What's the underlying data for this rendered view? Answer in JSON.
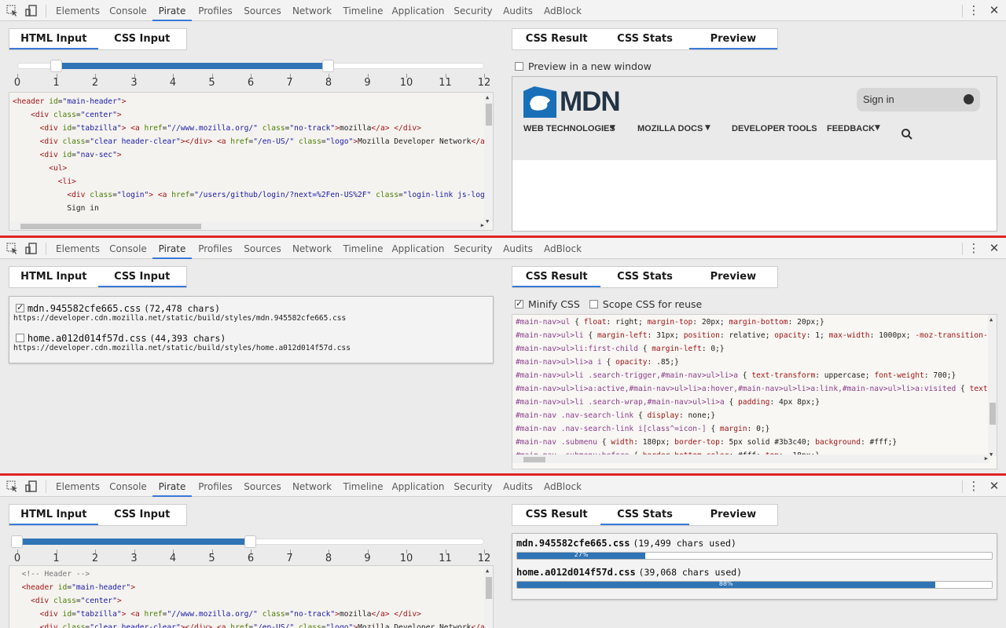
{
  "devtools_tabs": [
    "Elements",
    "Console",
    "Pirate",
    "Profiles",
    "Sources",
    "Network",
    "Timeline",
    "Application",
    "Security",
    "Audits",
    "AdBlock"
  ],
  "input_tabs": [
    "HTML Input",
    "CSS Input"
  ],
  "result_tabs": [
    "CSS Result",
    "CSS Stats",
    "Preview"
  ],
  "icons": {
    "inspect": "inspect-element-icon",
    "device": "device-mode-icon",
    "menu": "more-options-icon",
    "close": "close-icon"
  },
  "colors": {
    "accent": "#3879d9",
    "slider_fill": "#2f74b5",
    "divider": "#e02424"
  },
  "panel1": {
    "slider": {
      "ticks": [
        "0",
        "1",
        "2",
        "3",
        "4",
        "5",
        "6",
        "7",
        "8",
        "9",
        "10",
        "11",
        "12"
      ],
      "range_low": 1,
      "range_high": 8
    },
    "html_lines": [
      "<header id=\"main-header\">",
      "    <div class=\"center\">",
      "      <div id=\"tabzilla\"> <a href=\"//www.mozilla.org/\" class=\"no-track\">mozilla</a> </div>",
      "      <div class=\"clear header-clear\"></div> <a href=\"/en-US/\" class=\"logo\">Mozilla Developer Network</a>",
      "      <div id=\"nav-sec\">",
      "        <ul>",
      "          <li>",
      "            <div class=\"login\"> <a href=\"/users/github/login/?next=%2Fen-US%2F\" class=\"login-link js-login",
      "            Sign in"
    ],
    "preview_checkbox": "Preview in a new window",
    "mdn": {
      "logo_text": "MDN",
      "signin": "Sign in",
      "nav": [
        "WEB TECHNOLOGIES",
        "MOZILLA DOCS",
        "DEVELOPER TOOLS",
        "FEEDBACK"
      ]
    }
  },
  "panel2": {
    "files": [
      {
        "name": "mdn.945582cfe665.css",
        "chars": "(72,478 chars)",
        "url": "https://developer.cdn.mozilla.net/static/build/styles/mdn.945582cfe665.css",
        "checked": true
      },
      {
        "name": "home.a012d014f57d.css",
        "chars": "(44,393 chars)",
        "url": "https://developer.cdn.mozilla.net/static/build/styles/home.a012d014f57d.css",
        "checked": false
      }
    ],
    "minify_label": "Minify CSS",
    "scope_label": "Scope CSS for reuse",
    "css_lines": [
      [
        [
          "sel",
          "#main-nav>ul"
        ],
        [
          "pv",
          " { "
        ],
        [
          "prop",
          "float"
        ],
        [
          "pv",
          ": right; "
        ],
        [
          "prop",
          "margin-top"
        ],
        [
          "pv",
          ": 20px; "
        ],
        [
          "prop",
          "margin-bottom"
        ],
        [
          "pv",
          ": 20px;}"
        ]
      ],
      [
        [
          "sel",
          "#main-nav>ul>li"
        ],
        [
          "pv",
          " { "
        ],
        [
          "prop",
          "margin-left"
        ],
        [
          "pv",
          ": 31px; "
        ],
        [
          "prop",
          "position"
        ],
        [
          "pv",
          ": relative; "
        ],
        [
          "prop",
          "opacity"
        ],
        [
          "pv",
          ": 1; "
        ],
        [
          "prop",
          "max-width"
        ],
        [
          "pv",
          ": 1000px; "
        ],
        [
          "prop",
          "-moz-transition-pr"
        ]
      ],
      [
        [
          "sel",
          "#main-nav>ul>li:first-child"
        ],
        [
          "pv",
          " { "
        ],
        [
          "prop",
          "margin-left"
        ],
        [
          "pv",
          ": 0;}"
        ]
      ],
      [
        [
          "sel",
          "#main-nav>ul>li>a i"
        ],
        [
          "pv",
          " { "
        ],
        [
          "prop",
          "opacity"
        ],
        [
          "pv",
          ": .85;}"
        ]
      ],
      [
        [
          "sel",
          "#main-nav>ul>li .search-trigger,#main-nav>ul>li>a"
        ],
        [
          "pv",
          " { "
        ],
        [
          "prop",
          "text-transform"
        ],
        [
          "pv",
          ": uppercase; "
        ],
        [
          "prop",
          "font-weight"
        ],
        [
          "pv",
          ": 700;}"
        ]
      ],
      [
        [
          "sel",
          "#main-nav>ul>li>a:active,#main-nav>ul>li>a:hover,#main-nav>ul>li>a:link,#main-nav>ul>li>a:visited"
        ],
        [
          "pv",
          " { "
        ],
        [
          "prop",
          "text-d"
        ]
      ],
      [
        [
          "sel",
          "#main-nav>ul>li .search-wrap,#main-nav>ul>li>a"
        ],
        [
          "pv",
          " { "
        ],
        [
          "prop",
          "padding"
        ],
        [
          "pv",
          ": 4px 8px;}"
        ]
      ],
      [
        [
          "sel",
          "#main-nav .nav-search-link"
        ],
        [
          "pv",
          " { "
        ],
        [
          "prop",
          "display"
        ],
        [
          "pv",
          ": none;}"
        ]
      ],
      [
        [
          "sel",
          "#main-nav .nav-search-link i[class^=icon-]"
        ],
        [
          "pv",
          " { "
        ],
        [
          "prop",
          "margin"
        ],
        [
          "pv",
          ": 0;}"
        ]
      ],
      [
        [
          "sel",
          "#main-nav .submenu"
        ],
        [
          "pv",
          " { "
        ],
        [
          "prop",
          "width"
        ],
        [
          "pv",
          ": 180px; "
        ],
        [
          "prop",
          "border-top"
        ],
        [
          "pv",
          ": 5px solid #3b3c40; "
        ],
        [
          "prop",
          "background"
        ],
        [
          "pv",
          ": #fff;}"
        ]
      ],
      [
        [
          "sel",
          "#main-nav .submenu:before"
        ],
        [
          "pv",
          " { "
        ],
        [
          "prop",
          "border-bottom-color"
        ],
        [
          "pv",
          ": #fff; "
        ],
        [
          "prop",
          "top"
        ],
        [
          "pv",
          ": -18px;}"
        ]
      ]
    ]
  },
  "panel3": {
    "slider": {
      "ticks": [
        "0",
        "1",
        "2",
        "3",
        "4",
        "5",
        "6",
        "7",
        "8",
        "9",
        "10",
        "11",
        "12"
      ],
      "range_low": 0,
      "range_high": 6
    },
    "html_lines": [
      "  <!-- Header -->",
      "  <header id=\"main-header\">",
      "    <div class=\"center\">",
      "      <div id=\"tabzilla\"> <a href=\"//www.mozilla.org/\" class=\"no-track\">mozilla</a> </div>",
      "      <div class=\"clear header-clear\"></div> <a href=\"/en-US/\" class=\"logo\">Mozilla Developer Network</a>"
    ],
    "stats": [
      {
        "label": "mdn.945582cfe665.css",
        "used": "(19,499 chars used)",
        "percent": 27,
        "percent_label": "27%"
      },
      {
        "label": "home.a012d014f57d.css",
        "used": "(39,068 chars used)",
        "percent": 88,
        "percent_label": "88%"
      }
    ]
  }
}
